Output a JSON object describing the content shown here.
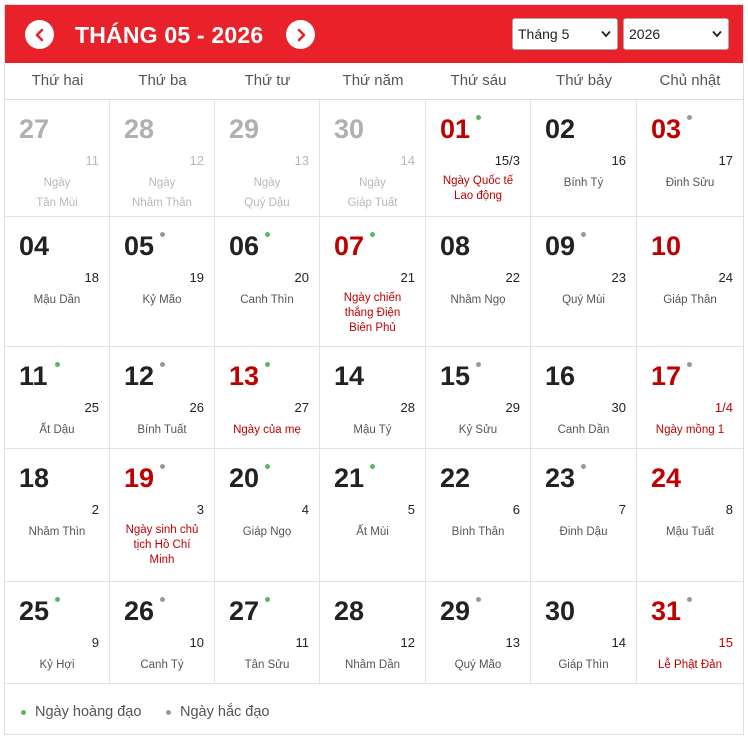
{
  "header": {
    "title": "THÁNG 05 - 2026",
    "month_select": "Tháng 5",
    "year_select": "2026",
    "prev_icon": "chevron-left-icon",
    "next_icon": "chevron-right-icon"
  },
  "colors": {
    "brand_red": "#e8212b",
    "holiday_red": "#c00000",
    "good_day_dot": "#5cb85c",
    "bad_day_dot": "#999999"
  },
  "weekdays": [
    "Thứ hai",
    "Thứ ba",
    "Thứ tư",
    "Thứ năm",
    "Thứ sáu",
    "Thứ bảy",
    "Chủ nhật"
  ],
  "weeks": [
    [
      {
        "day": "27",
        "lunar": "11",
        "canchi": "Ngày\nTân Mùi",
        "outside": true
      },
      {
        "day": "28",
        "lunar": "12",
        "canchi": "Ngày\nNhâm Thân",
        "outside": true
      },
      {
        "day": "29",
        "lunar": "13",
        "canchi": "Ngày\nQuý Dậu",
        "outside": true
      },
      {
        "day": "30",
        "lunar": "14",
        "canchi": "Ngày\nGiáp Tuất",
        "outside": true
      },
      {
        "day": "01",
        "lunar": "15/3",
        "event": "Ngày Quốc tế\nLao động",
        "dot": "good",
        "red": true
      },
      {
        "day": "02",
        "lunar": "16",
        "canchi": "Bính Tý"
      },
      {
        "day": "03",
        "lunar": "17",
        "canchi": "Đinh Sửu",
        "dot": "bad",
        "red": true
      }
    ],
    [
      {
        "day": "04",
        "lunar": "18",
        "canchi": "Mậu Dần"
      },
      {
        "day": "05",
        "lunar": "19",
        "canchi": "Kỷ Mão",
        "dot": "bad"
      },
      {
        "day": "06",
        "lunar": "20",
        "canchi": "Canh Thìn",
        "dot": "good"
      },
      {
        "day": "07",
        "lunar": "21",
        "event": "Ngày chiến\nthắng Điện\nBiên Phủ",
        "dot": "good",
        "red": true
      },
      {
        "day": "08",
        "lunar": "22",
        "canchi": "Nhâm Ngọ"
      },
      {
        "day": "09",
        "lunar": "23",
        "canchi": "Quý Mùi",
        "dot": "bad"
      },
      {
        "day": "10",
        "lunar": "24",
        "canchi": "Giáp Thân",
        "red": true
      }
    ],
    [
      {
        "day": "11",
        "lunar": "25",
        "canchi": "Ất Dậu",
        "dot": "good"
      },
      {
        "day": "12",
        "lunar": "26",
        "canchi": "Bính Tuất",
        "dot": "bad"
      },
      {
        "day": "13",
        "lunar": "27",
        "event": "Ngày của mẹ",
        "dot": "good",
        "red": true
      },
      {
        "day": "14",
        "lunar": "28",
        "canchi": "Mậu Tý"
      },
      {
        "day": "15",
        "lunar": "29",
        "canchi": "Kỷ Sửu",
        "dot": "bad"
      },
      {
        "day": "16",
        "lunar": "30",
        "canchi": "Canh Dần"
      },
      {
        "day": "17",
        "lunar": "1/4",
        "event": "Ngày mồng 1",
        "dot": "bad",
        "red": true,
        "lunar_red": true
      }
    ],
    [
      {
        "day": "18",
        "lunar": "2",
        "canchi": "Nhâm Thìn"
      },
      {
        "day": "19",
        "lunar": "3",
        "event": "Ngày sinh chủ\ntịch Hồ Chí\nMinh",
        "dot": "bad",
        "red": true
      },
      {
        "day": "20",
        "lunar": "4",
        "canchi": "Giáp Ngọ",
        "dot": "good"
      },
      {
        "day": "21",
        "lunar": "5",
        "canchi": "Ất Mùi",
        "dot": "good"
      },
      {
        "day": "22",
        "lunar": "6",
        "canchi": "Bính Thân"
      },
      {
        "day": "23",
        "lunar": "7",
        "canchi": "Đinh Dậu",
        "dot": "bad"
      },
      {
        "day": "24",
        "lunar": "8",
        "canchi": "Mậu Tuất",
        "red": true
      }
    ],
    [
      {
        "day": "25",
        "lunar": "9",
        "canchi": "Kỷ Hợi",
        "dot": "good"
      },
      {
        "day": "26",
        "lunar": "10",
        "canchi": "Canh Tý",
        "dot": "bad"
      },
      {
        "day": "27",
        "lunar": "11",
        "canchi": "Tân Sửu",
        "dot": "good"
      },
      {
        "day": "28",
        "lunar": "12",
        "canchi": "Nhâm Dần"
      },
      {
        "day": "29",
        "lunar": "13",
        "canchi": "Quý Mão",
        "dot": "bad"
      },
      {
        "day": "30",
        "lunar": "14",
        "canchi": "Giáp Thìn"
      },
      {
        "day": "31",
        "lunar": "15",
        "event": "Lễ Phật Đản",
        "dot": "bad",
        "red": true,
        "lunar_red": true
      }
    ]
  ],
  "legend": {
    "good": "Ngày hoàng đạo",
    "bad": "Ngày hắc đạo"
  }
}
